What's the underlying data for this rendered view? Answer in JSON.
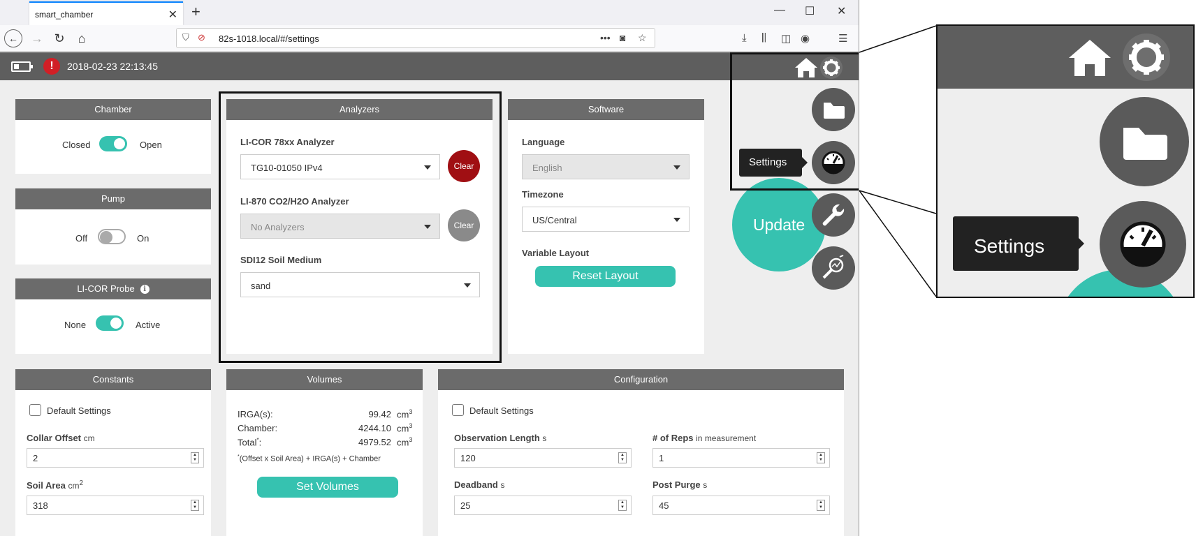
{
  "browser": {
    "tab_title": "smart_chamber",
    "tab_close": "✕",
    "new_tab": "+",
    "url": "82s-1018.local/#/settings",
    "url_menu": "•••",
    "window_minimize": "—",
    "window_maximize": "☐",
    "window_close": "✕"
  },
  "header": {
    "datetime": "2018-02-23 22:13:45",
    "alert_symbol": "!"
  },
  "chamber": {
    "title": "Chamber",
    "left_label": "Closed",
    "right_label": "Open",
    "state": "open"
  },
  "pump": {
    "title": "Pump",
    "left_label": "Off",
    "right_label": "On",
    "state": "off"
  },
  "probe": {
    "title": "LI-COR Probe",
    "info_symbol": "i",
    "left_label": "None",
    "right_label": "Active",
    "state": "active"
  },
  "analyzers": {
    "title": "Analyzers",
    "licor78xx_label": "LI-COR 78xx Analyzer",
    "licor78xx_value": "TG10-01050 IPv4",
    "licor78xx_clear": "Clear",
    "li870_label": "LI-870 CO2/H2O Analyzer",
    "li870_value": "No Analyzers",
    "li870_clear": "Clear",
    "sdi12_label": "SDI12 Soil Medium",
    "sdi12_value": "sand",
    "clear_active_color": "#a00f13",
    "clear_disabled_color": "#8a8a8a"
  },
  "software": {
    "title": "Software",
    "language_label": "Language",
    "language_value": "English",
    "timezone_label": "Timezone",
    "timezone_value": "US/Central",
    "layout_label": "Variable Layout",
    "reset_button": "Reset Layout"
  },
  "constants": {
    "title": "Constants",
    "default_label": "Default Settings",
    "collar_label": "Collar Offset",
    "collar_unit": "cm",
    "collar_value": "2",
    "soil_label": "Soil Area",
    "soil_unit": "cm",
    "soil_unit_sup": "2",
    "soil_value": "318"
  },
  "volumes": {
    "title": "Volumes",
    "irga_label": "IRGA(s):",
    "irga_value": "99.42",
    "chamber_label": "Chamber:",
    "chamber_value": "4244.10",
    "total_label": "Total",
    "total_star": "*",
    "total_colon": ":",
    "total_value": "4979.52",
    "unit": "cm",
    "unit_sup": "3",
    "footnote_star": "*",
    "footnote": "(Offset x Soil Area) + IRGA(s) + Chamber",
    "button": "Set Volumes"
  },
  "configuration": {
    "title": "Configuration",
    "default_label": "Default Settings",
    "obs_label": "Observation Length",
    "obs_unit": "s",
    "obs_value": "120",
    "reps_label": "# of Reps",
    "reps_unit": "in measurement",
    "reps_value": "1",
    "deadband_label": "Deadband",
    "deadband_unit": "s",
    "deadband_value": "25",
    "purge_label": "Post Purge",
    "purge_unit": "s",
    "purge_value": "45"
  },
  "nav": {
    "update_label": "Update",
    "tooltip": "Settings",
    "zoom_tooltip": "Settings"
  },
  "colors": {
    "accent": "#36c2b0",
    "header": "#5e5e5e",
    "panel_header": "#6b6b6b",
    "fab": "#5a5a5a"
  }
}
